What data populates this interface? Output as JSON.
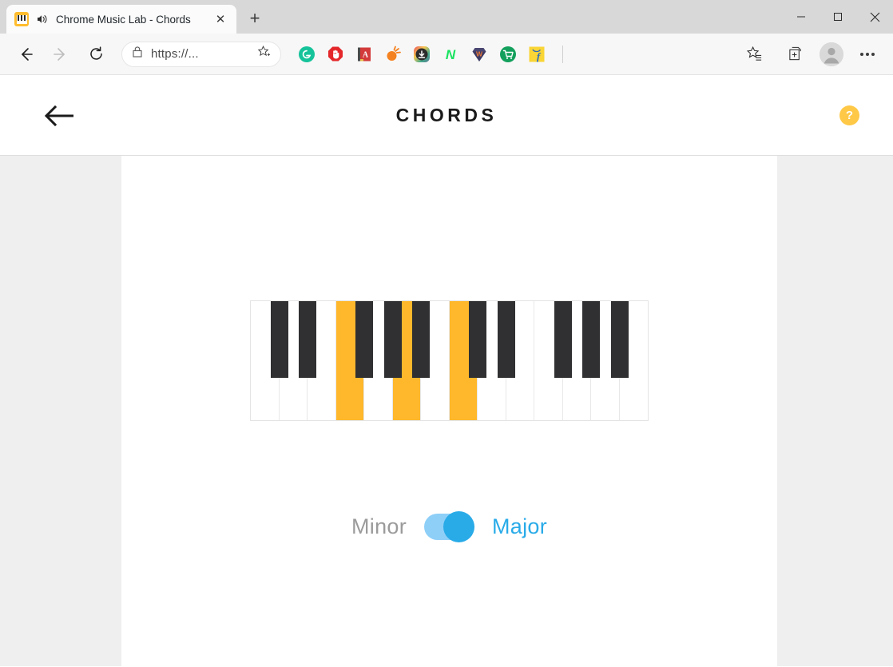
{
  "browser": {
    "tab": {
      "title": "Chrome Music Lab - Chords",
      "favicon_name": "piano-keys-favicon",
      "favicon_color": "#ffbd2e",
      "audio_indicator": "speaker-playing-icon",
      "close_label": "✕"
    },
    "new_tab_label": "+",
    "window_controls": {
      "minimize": "—",
      "maximize": "□",
      "close": "✕"
    },
    "nav": {
      "back": "←",
      "forward": "→",
      "reload": "↻"
    },
    "omnibox": {
      "lock_icon": "site-security-lock-icon",
      "url": "https://...",
      "favorite_icon": "add-favorite-star-icon"
    },
    "extensions": [
      {
        "name": "grammarly-extension",
        "glyph": "G",
        "color": "#15c39a"
      },
      {
        "name": "adblock-extension",
        "glyph": "✋",
        "color": "#e4272a"
      },
      {
        "name": "dictionary-extension",
        "glyph": "A",
        "color": "#d33a3a"
      },
      {
        "name": "honey-extension",
        "glyph": "●",
        "color": "#f58220"
      },
      {
        "name": "downloader-extension",
        "glyph": "⬇",
        "color": "#2b2b2b"
      },
      {
        "name": "naver-extension",
        "glyph": "N",
        "color": "#18e35f"
      },
      {
        "name": "wikibuy-extension",
        "glyph": "W",
        "color": "#3d3a63"
      },
      {
        "name": "shopping-cart-extension",
        "glyph": "🛒",
        "color": "#13a05c"
      },
      {
        "name": "flipkart-extension",
        "glyph": "f",
        "color": "#f9d535"
      }
    ],
    "right_tools": {
      "favorites": "favorites-star-icon",
      "collections": "collections-icon",
      "profile": "profile-avatar",
      "settings": "settings-more-icon"
    }
  },
  "app": {
    "back_label": "back-arrow",
    "title": "CHORDS",
    "help_label": "?",
    "help_color": "#ffc846"
  },
  "piano": {
    "white_keys": [
      {
        "note": "C",
        "active": false
      },
      {
        "note": "D",
        "active": false
      },
      {
        "note": "E",
        "active": false
      },
      {
        "note": "F",
        "active": true
      },
      {
        "note": "G",
        "active": false
      },
      {
        "note": "A",
        "active": true
      },
      {
        "note": "B",
        "active": false
      },
      {
        "note": "C",
        "active": true
      },
      {
        "note": "D",
        "active": false
      },
      {
        "note": "E",
        "active": false
      },
      {
        "note": "F",
        "active": false
      },
      {
        "note": "G",
        "active": false
      },
      {
        "note": "A",
        "active": false
      },
      {
        "note": "B",
        "active": false
      }
    ],
    "black_keys": [
      {
        "note": "C#",
        "after": 0,
        "active": false
      },
      {
        "note": "D#",
        "after": 1,
        "active": false
      },
      {
        "note": "F#",
        "after": 3,
        "active": false
      },
      {
        "note": "G#",
        "after": 4,
        "active": false
      },
      {
        "note": "A#",
        "after": 5,
        "active": false
      },
      {
        "note": "C#",
        "after": 7,
        "active": false
      },
      {
        "note": "D#",
        "after": 8,
        "active": false
      },
      {
        "note": "F#",
        "after": 10,
        "active": false
      },
      {
        "note": "G#",
        "after": 11,
        "active": false
      },
      {
        "note": "A#",
        "after": 12,
        "active": false
      }
    ],
    "active_color": "#ffb72b",
    "black_color": "#303032",
    "white_color": "#ffffff"
  },
  "toggle": {
    "left_label": "Minor",
    "right_label": "Major",
    "selected": "Major",
    "track_color": "#8ecff8",
    "thumb_color": "#29abe8",
    "active_text_color": "#29abe8",
    "inactive_text_color": "#9b9b9b"
  }
}
